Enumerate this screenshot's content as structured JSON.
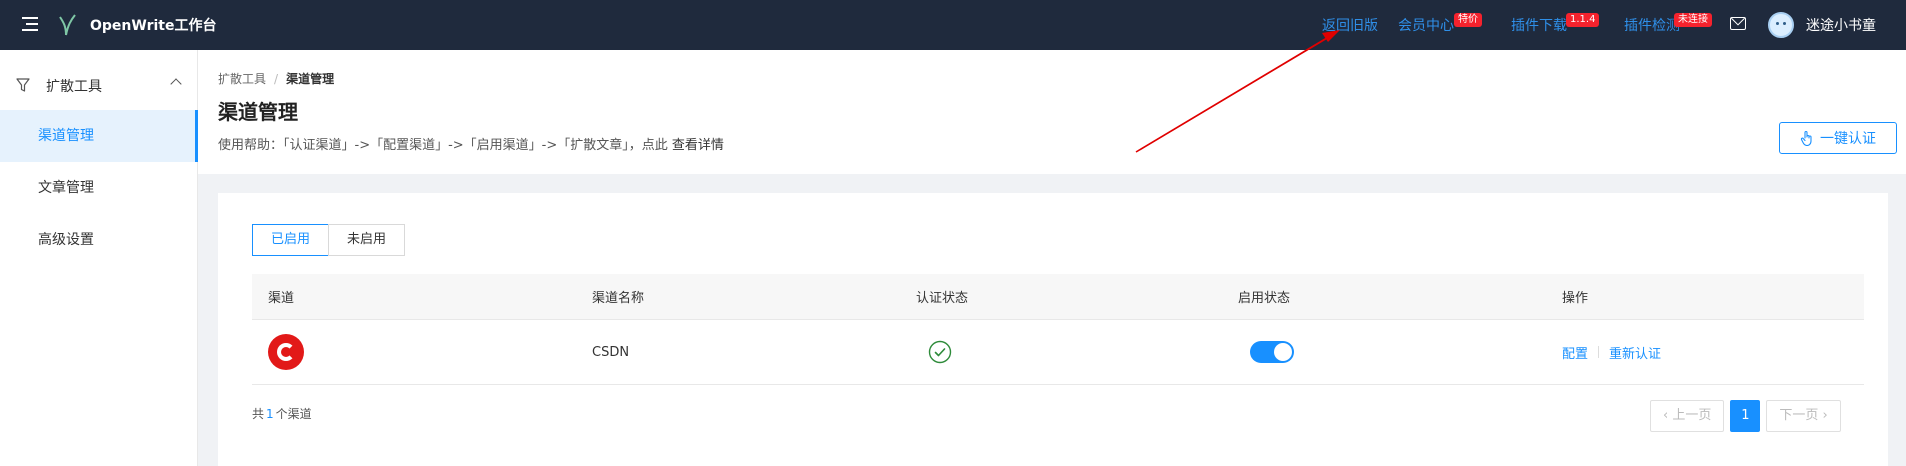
{
  "topbar": {
    "brand": "OpenWrite工作台",
    "links": {
      "old_version": "返回旧版",
      "member_center": "会员中心",
      "plugin_download": "插件下载",
      "plugin_check": "插件检测"
    },
    "badges": {
      "member_center": "特价",
      "plugin_download": "1.1.4",
      "plugin_check": "未连接"
    },
    "username": "迷途小书童",
    "icons": [
      "menu-icon",
      "logo-icon",
      "mail-icon",
      "avatar"
    ]
  },
  "sidebar": {
    "group_label": "扩散工具",
    "items": [
      {
        "label": "渠道管理",
        "active": true
      },
      {
        "label": "文章管理",
        "active": false
      },
      {
        "label": "高级设置",
        "active": false
      }
    ]
  },
  "header": {
    "breadcrumb": [
      "扩散工具",
      "渠道管理"
    ],
    "title": "渠道管理",
    "help_prefix": "使用帮助：「认证渠道」->「配置渠道」->「启用渠道」->「扩散文章」，点此",
    "help_link": "查看详情",
    "auth_button": "一键认证"
  },
  "tabs": [
    {
      "label": "已启用",
      "active": true
    },
    {
      "label": "未启用",
      "active": false
    }
  ],
  "table": {
    "columns": [
      "渠道",
      "渠道名称",
      "认证状态",
      "启用状态",
      "操作"
    ],
    "rows": [
      {
        "channel_icon": "csdn-logo",
        "name": "CSDN",
        "auth_status": "check-icon",
        "enabled": true,
        "actions": [
          "配置",
          "重新认证"
        ]
      }
    ]
  },
  "footer": {
    "count_prefix": "共",
    "count": "1",
    "count_suffix": "个渠道",
    "prev": "上一页",
    "current_page": "1",
    "next": "下一页"
  },
  "colors": {
    "topbar_bg": "#1f2a3d",
    "accent": "#1890ff",
    "badge": "#f5222d",
    "annotation_arrow": "#e00000"
  }
}
